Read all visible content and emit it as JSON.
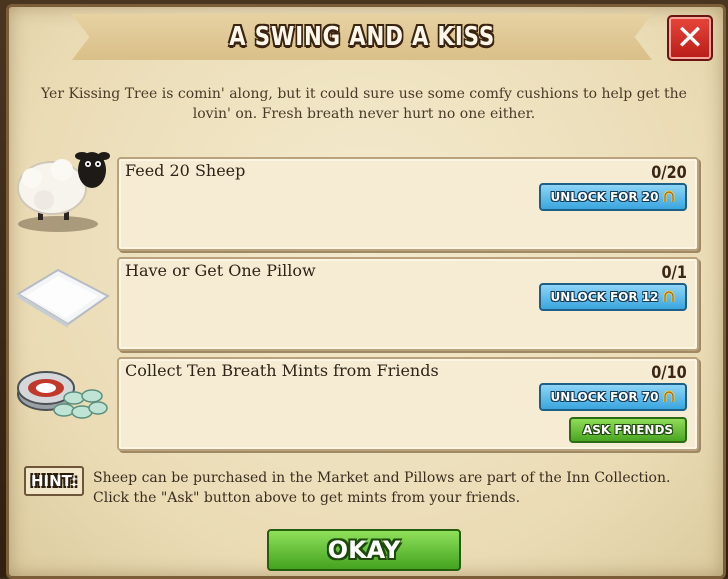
{
  "dialog": {
    "title": "A SWING AND A KISS",
    "close_symbol": "✕",
    "intro": "Yer Kissing Tree is comin' along, but it could sure use some comfy cushions to help get the lovin' on. Fresh breath never hurt no one either."
  },
  "tasks": [
    {
      "label": "Feed 20 Sheep",
      "count": "0/20",
      "unlock_label": "UNLOCK FOR 20",
      "icon": "sheep-icon"
    },
    {
      "label": "Have or Get One Pillow",
      "count": "0/1",
      "unlock_label": "UNLOCK FOR 12",
      "icon": "pillow-icon"
    },
    {
      "label": "Collect Ten Breath Mints from Friends",
      "count": "0/10",
      "unlock_label": "UNLOCK FOR 70",
      "icon": "breath-mints-icon",
      "ask_label": "ASK FRIENDS"
    }
  ],
  "hint": {
    "tag": "HINT:",
    "text": "Sheep can be purchased in the Market and Pillows are part of the Inn Collection. Click the \"Ask\" button above to get mints from your friends."
  },
  "okay_label": "OKAY",
  "colors": {
    "unlock_button": "#3aa6de",
    "green_button": "#4aa522",
    "close_button": "#c8231c",
    "parchment": "#f4ebcf"
  }
}
